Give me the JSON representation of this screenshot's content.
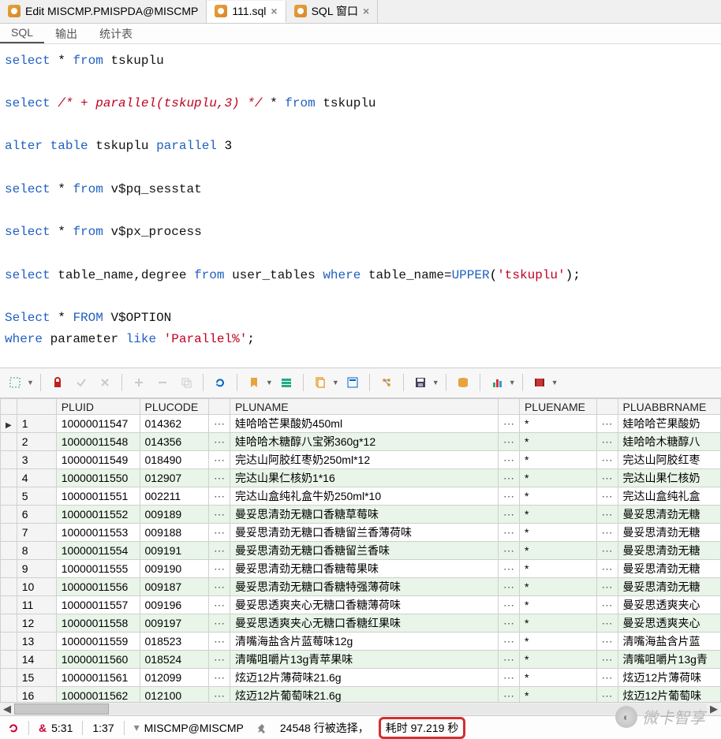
{
  "tabs": [
    {
      "label": "Edit MISCMP.PMISPDA@MISCMP",
      "active": false,
      "closable": false
    },
    {
      "label": "111.sql",
      "active": true,
      "closable": true
    },
    {
      "label": "SQL 窗口",
      "active": false,
      "closable": true
    }
  ],
  "subtabs": [
    {
      "label": "SQL",
      "active": true
    },
    {
      "label": "输出",
      "active": false
    },
    {
      "label": "统计表",
      "active": false
    }
  ],
  "sql_lines": [
    [
      [
        "kw",
        "select"
      ],
      [
        "",
        ""
      ],
      [
        "",
        "*"
      ],
      [
        "",
        ""
      ],
      [
        "kw",
        "from"
      ],
      [
        "",
        ""
      ],
      [
        "id",
        "tskuplu"
      ]
    ],
    [],
    [
      [
        "kw",
        "select"
      ],
      [
        "",
        ""
      ],
      [
        "cm",
        "/* + parallel(tskuplu,3) */"
      ],
      [
        "",
        ""
      ],
      [
        "",
        "*"
      ],
      [
        "",
        ""
      ],
      [
        "kw",
        "from"
      ],
      [
        "",
        ""
      ],
      [
        "id",
        "tskuplu"
      ]
    ],
    [],
    [
      [
        "kw",
        "alter"
      ],
      [
        "",
        ""
      ],
      [
        "kw",
        "table"
      ],
      [
        "",
        ""
      ],
      [
        "id",
        "tskuplu"
      ],
      [
        "",
        ""
      ],
      [
        "kw",
        "parallel"
      ],
      [
        "",
        ""
      ],
      [
        "num",
        "3"
      ]
    ],
    [],
    [
      [
        "kw",
        "select"
      ],
      [
        "",
        ""
      ],
      [
        "",
        "*"
      ],
      [
        "",
        ""
      ],
      [
        "kw",
        "from"
      ],
      [
        "",
        ""
      ],
      [
        "id",
        "v$pq_sesstat"
      ]
    ],
    [],
    [
      [
        "kw",
        "select"
      ],
      [
        "",
        ""
      ],
      [
        "",
        "*"
      ],
      [
        "",
        ""
      ],
      [
        "kw",
        "from"
      ],
      [
        "",
        ""
      ],
      [
        "id",
        "v$px_process"
      ]
    ],
    [],
    [
      [
        "kw",
        "select"
      ],
      [
        "",
        ""
      ],
      [
        "id",
        "table_name,degree"
      ],
      [
        "",
        ""
      ],
      [
        "kw",
        "from"
      ],
      [
        "",
        ""
      ],
      [
        "id",
        "user_tables"
      ],
      [
        "",
        ""
      ],
      [
        "kw",
        "where"
      ],
      [
        "",
        ""
      ],
      [
        "id",
        "table_name="
      ],
      [
        "func",
        "UPPER"
      ],
      [
        "",
        "("
      ],
      [
        "str",
        "'tskuplu'"
      ],
      [
        "",
        ");"
      ]
    ],
    [],
    [
      [
        "kw",
        "Select"
      ],
      [
        "",
        ""
      ],
      [
        "",
        "*"
      ],
      [
        "",
        ""
      ],
      [
        "kw",
        "FROM"
      ],
      [
        "",
        ""
      ],
      [
        "id",
        "V$OPTION"
      ]
    ],
    [
      [
        "kw",
        "where"
      ],
      [
        "",
        ""
      ],
      [
        "id",
        "parameter"
      ],
      [
        "",
        ""
      ],
      [
        "kw",
        "like"
      ],
      [
        "",
        ""
      ],
      [
        "str",
        "'Parallel%'"
      ],
      [
        "",
        ";"
      ]
    ]
  ],
  "columns": [
    "",
    "",
    "PLUID",
    "PLUCODE",
    "",
    "PLUNAME",
    "",
    "PLUENAME",
    "",
    "PLUABBRNAME"
  ],
  "rows": [
    {
      "n": 1,
      "pluid": "10000011547",
      "plucode": "014362",
      "pluname": "娃哈哈芒果酸奶450ml",
      "pluename": "*",
      "abbr": "娃哈哈芒果酸奶"
    },
    {
      "n": 2,
      "pluid": "10000011548",
      "plucode": "014356",
      "pluname": "娃哈哈木糖醇八宝粥360g*12",
      "pluename": "*",
      "abbr": "娃哈哈木糖醇八"
    },
    {
      "n": 3,
      "pluid": "10000011549",
      "plucode": "018490",
      "pluname": "完达山阿胶红枣奶250ml*12",
      "pluename": "*",
      "abbr": "完达山阿胶红枣"
    },
    {
      "n": 4,
      "pluid": "10000011550",
      "plucode": "012907",
      "pluname": "完达山果仁核奶1*16",
      "pluename": "*",
      "abbr": "完达山果仁核奶"
    },
    {
      "n": 5,
      "pluid": "10000011551",
      "plucode": "002211",
      "pluname": "完达山盒纯礼盒牛奶250ml*10",
      "pluename": "*",
      "abbr": "完达山盒纯礼盒"
    },
    {
      "n": 6,
      "pluid": "10000011552",
      "plucode": "009189",
      "pluname": "曼妥思清劲无糖口香糖草莓味",
      "pluename": "*",
      "abbr": "曼妥思清劲无糖"
    },
    {
      "n": 7,
      "pluid": "10000011553",
      "plucode": "009188",
      "pluname": "曼妥思清劲无糖口香糖留兰香薄荷味",
      "pluename": "*",
      "abbr": "曼妥思清劲无糖"
    },
    {
      "n": 8,
      "pluid": "10000011554",
      "plucode": "009191",
      "pluname": "曼妥思清劲无糖口香糖留兰香味",
      "pluename": "*",
      "abbr": "曼妥思清劲无糖"
    },
    {
      "n": 9,
      "pluid": "10000011555",
      "plucode": "009190",
      "pluname": "曼妥思清劲无糖口香糖莓果味",
      "pluename": "*",
      "abbr": "曼妥思清劲无糖"
    },
    {
      "n": 10,
      "pluid": "10000011556",
      "plucode": "009187",
      "pluname": "曼妥思清劲无糖口香糖特强薄荷味",
      "pluename": "*",
      "abbr": "曼妥思清劲无糖"
    },
    {
      "n": 11,
      "pluid": "10000011557",
      "plucode": "009196",
      "pluname": "曼妥思透爽夹心无糖口香糖薄荷味",
      "pluename": "*",
      "abbr": "曼妥思透爽夹心"
    },
    {
      "n": 12,
      "pluid": "10000011558",
      "plucode": "009197",
      "pluname": "曼妥思透爽夹心无糖口香糖红果味",
      "pluename": "*",
      "abbr": "曼妥思透爽夹心"
    },
    {
      "n": 13,
      "pluid": "10000011559",
      "plucode": "018523",
      "pluname": "清嘴海盐含片蓝莓味12g",
      "pluename": "*",
      "abbr": "清嘴海盐含片蓝"
    },
    {
      "n": 14,
      "pluid": "10000011560",
      "plucode": "018524",
      "pluname": "清嘴咀嚼片13g青苹果味",
      "pluename": "*",
      "abbr": "清嘴咀嚼片13g青"
    },
    {
      "n": 15,
      "pluid": "10000011561",
      "plucode": "012099",
      "pluname": "炫迈12片薄荷味21.6g",
      "pluename": "*",
      "abbr": "炫迈12片薄荷味"
    },
    {
      "n": 16,
      "pluid": "10000011562",
      "plucode": "012100",
      "pluname": "炫迈12片葡萄味21.6g",
      "pluename": "*",
      "abbr": "炫迈12片葡萄味"
    }
  ],
  "status": {
    "pos1": "5:31",
    "pos2": "1:37",
    "conn": "MISCMP@MISCMP",
    "rows_label": "24548 行被选择，",
    "time_label": "耗时 97.219 秒"
  },
  "watermark": "微卡智享",
  "ellipsis": "⋯"
}
